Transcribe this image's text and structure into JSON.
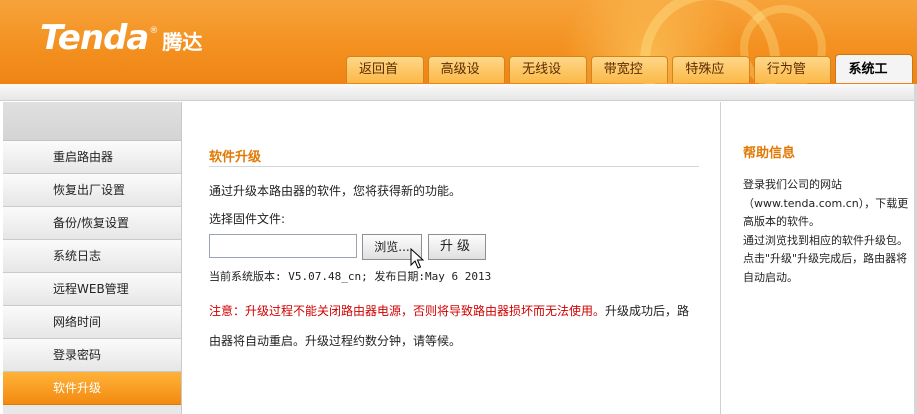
{
  "brand": {
    "logo_en": "Tenda",
    "logo_reg": "®",
    "logo_cn": "腾达",
    "accent_color": "#f39121",
    "title_color": "#e07a05"
  },
  "nav_tabs": [
    {
      "label": "返回首页",
      "active": false
    },
    {
      "label": "高级设置",
      "active": false
    },
    {
      "label": "无线设置",
      "active": false
    },
    {
      "label": "带宽控制",
      "active": false
    },
    {
      "label": "特殊应用",
      "active": false
    },
    {
      "label": "行为管理",
      "active": false
    },
    {
      "label": "系统工具",
      "active": true
    }
  ],
  "sidebar": {
    "items": [
      {
        "label": "重启路由器",
        "active": false
      },
      {
        "label": "恢复出厂设置",
        "active": false
      },
      {
        "label": "备份/恢复设置",
        "active": false
      },
      {
        "label": "系统日志",
        "active": false
      },
      {
        "label": "远程WEB管理",
        "active": false
      },
      {
        "label": "网络时间",
        "active": false
      },
      {
        "label": "登录密码",
        "active": false
      },
      {
        "label": "软件升级",
        "active": true
      }
    ]
  },
  "main": {
    "title": "软件升级",
    "description": "通过升级本路由器的软件，您将获得新的功能。",
    "file_label": "选择固件文件:",
    "file_value": "",
    "browse_label": "浏览...",
    "upgrade_label": "升级",
    "version_text": "当前系统版本: V5.07.48_cn; 发布日期:May 6 2013",
    "notice_red": "注意：升级过程不能关闭路由器电源，否则将导致路由器损坏而无法使用。",
    "notice_normal": "升级成功后，路由器将自动重启。升级过程约数分钟，请等候。"
  },
  "help": {
    "title": "帮助信息",
    "text_1": "登录我们公司的网站（www.tenda.com.cn），下载更高版本的软件。",
    "text_2": "通过浏览找到相应的软件升级包。",
    "text_3": "点击\"升级\"升级完成后，路由器将自动启动。"
  }
}
